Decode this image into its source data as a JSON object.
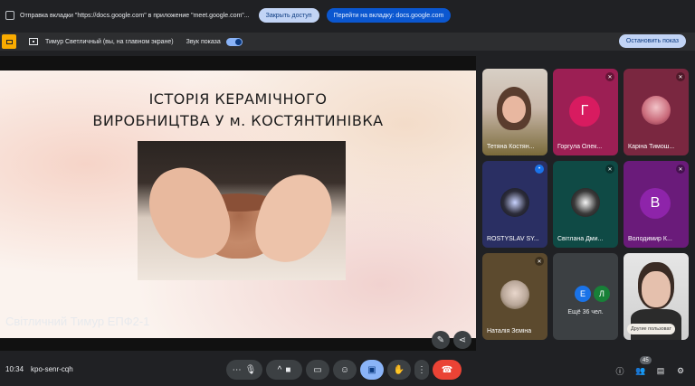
{
  "banner": {
    "message": "Отправка вкладки \"https://docs.google.com\" в приложение \"meet.google.com\"...",
    "close_access": "Закрыть доступ",
    "goto_tab": "Перейти на вкладку: docs.google.com"
  },
  "present_bar": {
    "presenter_label": "Тимур Светличный (вы, на главном экране)",
    "sound_label": "Звук показа",
    "sound_on": true,
    "stop_button": "Остановить показ"
  },
  "slide": {
    "title_line1": "ІСТОРІЯ КЕРАМІЧНОГО",
    "title_line2": "ВИРОБНИЦТВА У м. КОСТЯНТИНІВКА"
  },
  "stage": {
    "presenter_name": "Світличний Тимур ЕПФ2-1"
  },
  "participants": [
    {
      "name": "Тетяна Костян...",
      "type": "video"
    },
    {
      "name": "Горгула Олек...",
      "letter": "Г",
      "color": "#d81b60"
    },
    {
      "name": "Каріна Тимош...",
      "type": "avatar"
    },
    {
      "name": "ROSTYSLAV SY...",
      "type": "avatar"
    },
    {
      "name": "Світлана Дми...",
      "type": "avatar"
    },
    {
      "name": "Володимир К...",
      "letter": "В",
      "color": "#8e24aa"
    },
    {
      "name": "Наталія Зєміна",
      "type": "avatar"
    }
  ],
  "more_tile": {
    "letters": [
      "Е",
      "Л"
    ],
    "label": "Ещё 36 чел."
  },
  "self_tile": {
    "other_users": "Другие пользоват"
  },
  "bottom": {
    "time": "10:34",
    "meeting_code": "kpo-senr-cqh",
    "people_count": "45"
  },
  "colors": {
    "accent": "#8ab4f8",
    "leave": "#ea4335",
    "banner_primary": "#0b57d0"
  }
}
